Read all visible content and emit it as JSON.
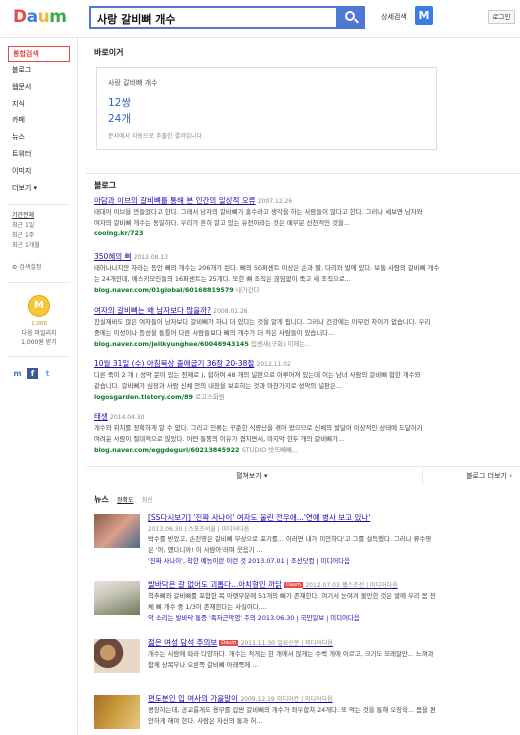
{
  "header": {
    "logo_letters": [
      "D",
      "a",
      "u",
      "m"
    ],
    "logo_colors": [
      "#e54b4b",
      "#3b7de0",
      "#f2b630",
      "#39a94a"
    ],
    "search_query": "사랑 갈비뼈 개수",
    "advanced_label": "상세검색",
    "mic_label": "M",
    "login_label": "로그인"
  },
  "sidebar": {
    "items": [
      "통합검색",
      "블로그",
      "웹문서",
      "지식",
      "카페",
      "뉴스",
      "트위터",
      "이미지",
      "더보기 ▾"
    ],
    "period_title": "기간전체",
    "periods": [
      "최근 1일",
      "최근 1주",
      "최근 1개월"
    ],
    "settings_label": "⚙ 검색설정",
    "coin_label": "M",
    "coin_value": "1,000",
    "coin_caption": [
      "다음 마일리지",
      "1,000원 받기"
    ],
    "social_icons": [
      "m",
      "f",
      "t"
    ]
  },
  "calculator": {
    "section_title": "바로이거",
    "query": "사랑 갈비뼈 개수",
    "values": [
      "12쌍",
      "24개"
    ],
    "note": "문서에서 자동으로 추출한 결과입니다."
  },
  "blog": {
    "section_title": "블로그",
    "items": [
      {
        "title": "아담과 이브의 갈비뼈를 통해 본 인간의 일상적 오류",
        "date": "2007.12.26",
        "desc": "태대어 이브을 만들었다고 한다. 그래서 남자의 갈비뼈가 홍수라고 생각을 하는 사람들이 많다고 한다. 그러나 세보면 남자와",
        "desc2": "여자의 갈비뼈 개수는 동일하다. 우리가 흔히 알고 있는 유전이라는 것은 매부분 선천적인 것을...",
        "url": "cooing.kr/723",
        "meta": ""
      },
      {
        "title": "350혜의 뼈",
        "date": "2012.08.13",
        "desc": "태어나나지만 자라는 동안 뼈의 개수는 206개가 된다. 뼈의 50퍼센트 이상은 손과 팔, 다리와 발에 있다. 보통 사람의 갈비뼈 개수",
        "desc2": "는 24개인데, 에스키모인들의 16퍼센트는 25개다. 또한 뼈 조직은 끊임없이 죽고 새 조직으로...",
        "url": "blog.naver.com/01global/60168819579",
        "meta": "내가간다"
      },
      {
        "title": "여자의 갈비뼈는 왜 남자보다 많을까?",
        "date": "2008.01.26",
        "desc": "잔실재바도 많은 여자들이 남자보다 갈비뼈가 하나 더 있다는 것을 알게 됩니다. 그러나 건강에는 아무런 차이가 없습니다. 우리",
        "desc2": "중에는 이성이나 등성을 통틀어 다른 사람들보다 뼈의 개수가 더 적은 사람들이 있습니다...",
        "url": "blog.naver.com/jellkyunghee/60046943145",
        "meta": "입센새(구회) 이제는..."
      },
      {
        "title": "10월 31일 (수) 아침묵상 출애굽기 36장 20-38절",
        "date": "2012.11.02",
        "desc": "다른 죽이 2 개 ( 성막 문이 있는 전제로 ), 합하여 48 개의 널판으로 이루어져 있는데 이는 남녀 사람의 갈비뼈 합한 개수와",
        "desc2": "같습니다. 갈비뼈가 심장과 사람 신체 안의 내장을 보호하는 것과 마찬가지로 성막의 널판은...",
        "url": "logosgarden.tistory.com/89",
        "meta": "로고스화원"
      },
      {
        "title": "태생",
        "date": "2014.04.30",
        "desc": "개수와 위치를 정확하게 알 수 없다. 그리고 인류는 꾸준한 식량난을 겪어 왔으므로 신체의 발달이 이상적인 상태에 도달하기",
        "desc2": "여려운 사람이 절대적으로 많았다. 어떤 통뚱의 이유가 겹치면서, 마지막 한두 개의 갈비뼈가...",
        "url": "blog.naver.com/eggdeguri/60213845922",
        "meta": "STUDIO 밧뜨빼빼..."
      }
    ],
    "fold_label": "펼쳐보기 ▾",
    "more_label": "블로그 더보기 ›"
  },
  "news": {
    "section_title": "뉴스",
    "tabs": [
      "정확도",
      "최신"
    ],
    "badge_label": "Daum",
    "items": [
      {
        "title": "[SS다시보기] '진짜 사나이' 여자도 울린 전우애...'연예 병사 보고 있나'",
        "source_line": "2013.06.30 | 스포츠서울 | 미디어다음",
        "desc": "박수를 받았고, 손진영은 갈비뼈 부상으로 포기를... 이러면 내가 미안하다'고 그를 설득했다. 그러나 류수영",
        "desc2": "은 '아, 했다니까! 이 사람아'라며 웃음기 ...",
        "related": "'진짜 사나이', 착한 예능이란 이런 것 2013.07.01 | 조선닷컴 | 미디어다음",
        "thumb": [
          "#8b5e4a",
          "#d9a08a",
          "#4a6a8a"
        ]
      },
      {
        "title": "발바닥은 갈 없어도 괴롭다...아치형인 까닭",
        "date": "2012.07.03",
        "source": "헬스조선 | 미디어다음",
        "desc": "척추뼈와 갈비뼈를 포함한 목 아랫부분에 51개의 뼈가 존재한다. 여기서 눈여겨 볼만한 것은 발에 우리 몸 전",
        "desc2": "체 뼈 개수 중 1/3이 존재한다는 사실이다....",
        "related": "악 소리는 발바닥 통증 '족저근막염' 주의 2013.06.30 | 국민일보 | 미디어다음",
        "thumb": [
          "#c8c4b8",
          "#6a7a5a",
          "#e8e4dc"
        ]
      },
      {
        "title": "젊은 여성 담석 주의보",
        "date": "2011.11.30",
        "source": "일요신문 | 미디어다음",
        "desc": "개수는 사람에 따라 다양하다. 개수는 적게는 한 개에서 많게는 수백 개에 이르고, 크기도 모래알만... 느껴과",
        "desc2": "함께 상복부나 오른쪽 갈비뼈 아래쪽에 ...",
        "related": "",
        "thumb": [
          "#6a4a3a",
          "#c89a6a",
          "#e8d8c8"
        ]
      },
      {
        "title": "편도분인 입 여사의 가을알이",
        "date": "2009.12.19",
        "source": "미디어칸 | 미디어다음",
        "desc": "콩장하는데, 공교롭게도 용부를 갑싼 갈비뼈의 개수가 좌우합쳐 24개다. 또 먹는 것을 통해 오장육... 몸을 편",
        "desc2": "안하게 해야 한다. 사람은 자신의 통과 허...",
        "related": "",
        "thumb": [
          "#c89a3a",
          "#e8c88a",
          "#a86a2a"
        ]
      }
    ]
  }
}
